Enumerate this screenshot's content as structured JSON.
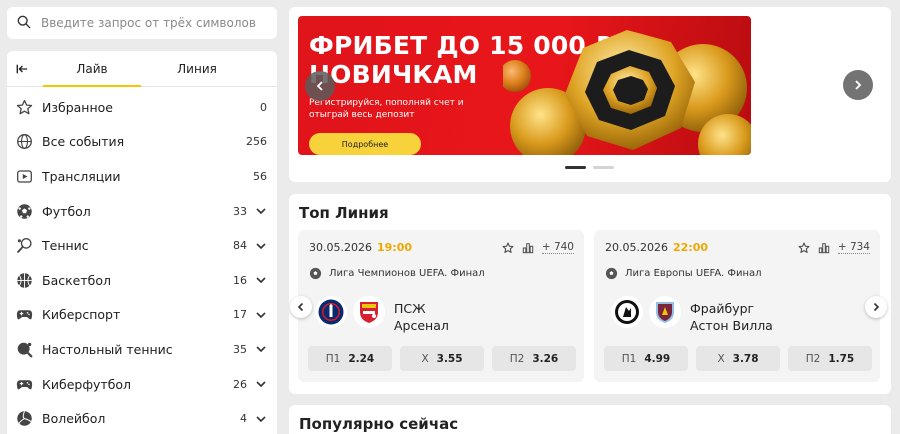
{
  "search": {
    "placeholder": "Введите запрос от трёх символов"
  },
  "sidebar": {
    "tabs": [
      {
        "label": "Лайв",
        "active": true
      },
      {
        "label": "Линия",
        "active": false
      }
    ],
    "items": [
      {
        "label": "Избранное",
        "count": "0",
        "icon": "star-icon",
        "expandable": false
      },
      {
        "label": "Все события",
        "count": "256",
        "icon": "globe-icon",
        "expandable": false
      },
      {
        "label": "Трансляции",
        "count": "56",
        "icon": "play-icon",
        "expandable": false
      },
      {
        "label": "Футбол",
        "count": "33",
        "icon": "soccer-ball-icon",
        "expandable": true
      },
      {
        "label": "Теннис",
        "count": "84",
        "icon": "tennis-racket-icon",
        "expandable": true
      },
      {
        "label": "Баскетбол",
        "count": "16",
        "icon": "basketball-icon",
        "expandable": true
      },
      {
        "label": "Киберспорт",
        "count": "17",
        "icon": "gamepad-icon",
        "expandable": true
      },
      {
        "label": "Настольный теннис",
        "count": "35",
        "icon": "ping-pong-icon",
        "expandable": true
      },
      {
        "label": "Киберфутбол",
        "count": "26",
        "icon": "gamepad-icon",
        "expandable": true
      },
      {
        "label": "Волейбол",
        "count": "4",
        "icon": "volleyball-icon",
        "expandable": true
      }
    ]
  },
  "banner": {
    "title_line1": "ФРИБЕТ ДО 15 000 ₽",
    "title_line2": "НОВИЧКАМ",
    "subtitle": "Регистрируйся, пополняй счет и отыграй весь депозит",
    "button_label": "Подробнее"
  },
  "top_line": {
    "title": "Топ Линия",
    "matches": [
      {
        "date": "30.05.2026",
        "time": "19:00",
        "more": "+ 740",
        "league": "Лига Чемпионов UEFA. Финал",
        "team1": "ПСЖ",
        "team2": "Арсенал",
        "odds": [
          {
            "label": "П1",
            "value": "2.24"
          },
          {
            "label": "Х",
            "value": "3.55"
          },
          {
            "label": "П2",
            "value": "3.26"
          }
        ]
      },
      {
        "date": "20.05.2026",
        "time": "22:00",
        "more": "+ 734",
        "league": "Лига Европы UEFA. Финал",
        "team1": "Фрайбург",
        "team2": "Астон Вилла",
        "odds": [
          {
            "label": "П1",
            "value": "4.99"
          },
          {
            "label": "Х",
            "value": "3.78"
          },
          {
            "label": "П2",
            "value": "1.75"
          }
        ]
      }
    ]
  },
  "popular": {
    "title": "Популярно сейчас"
  },
  "colors": {
    "accent": "#f7c400",
    "time": "#f0a800",
    "banner_red": "#e3161b"
  }
}
